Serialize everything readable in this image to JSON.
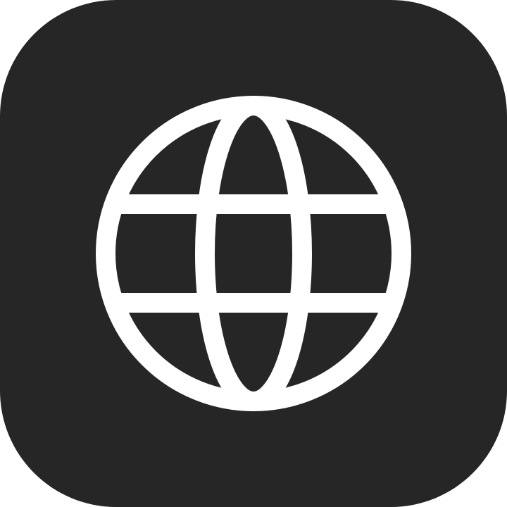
{
  "app_icon": {
    "icon": "globe-icon",
    "colors": {
      "background": "#262626",
      "glyph": "#ffffff"
    }
  }
}
